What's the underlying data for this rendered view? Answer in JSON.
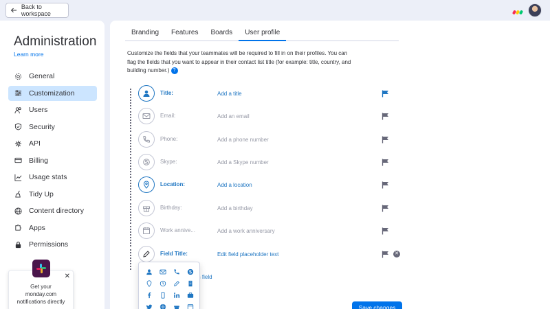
{
  "header": {
    "back_label": "Back to workspace"
  },
  "sidebar": {
    "title": "Administration",
    "learn_more": "Learn more",
    "items": [
      {
        "label": "General",
        "icon": "gear-icon"
      },
      {
        "label": "Customization",
        "icon": "sliders-icon",
        "active": true
      },
      {
        "label": "Users",
        "icon": "users-icon"
      },
      {
        "label": "Security",
        "icon": "shield-icon"
      },
      {
        "label": "API",
        "icon": "api-icon"
      },
      {
        "label": "Billing",
        "icon": "billing-icon"
      },
      {
        "label": "Usage stats",
        "icon": "chart-icon"
      },
      {
        "label": "Tidy Up",
        "icon": "broom-icon"
      },
      {
        "label": "Content directory",
        "icon": "globe-icon"
      },
      {
        "label": "Apps",
        "icon": "puzzle-icon"
      },
      {
        "label": "Permissions",
        "icon": "lock-icon"
      }
    ],
    "slack_promo": {
      "line1": "Get your",
      "line2": "monday.com",
      "line3": "notifications directly",
      "close": "✕"
    }
  },
  "tabs": [
    {
      "label": "Branding"
    },
    {
      "label": "Features"
    },
    {
      "label": "Boards"
    },
    {
      "label": "User profile",
      "active": true
    }
  ],
  "description": "Customize the fields that your teammates will be required to fill in on their profiles. You can flag the fields that you want to appear in their contact list title (for example: title, country, and building number.)",
  "help_icon": "?",
  "fields": [
    {
      "name": "Title:",
      "placeholder": "Add a title",
      "enabled": true,
      "flagged": true,
      "icon": "person-icon"
    },
    {
      "name": "Email:",
      "placeholder": "Add an email",
      "enabled": false,
      "flagged": false,
      "icon": "mail-icon"
    },
    {
      "name": "Phone:",
      "placeholder": "Add a phone number",
      "enabled": false,
      "flagged": false,
      "icon": "phone-icon"
    },
    {
      "name": "Skype:",
      "placeholder": "Add a Skype number",
      "enabled": false,
      "flagged": false,
      "icon": "skype-icon"
    },
    {
      "name": "Location:",
      "placeholder": "Add a location",
      "enabled": true,
      "flagged": false,
      "icon": "location-icon"
    },
    {
      "name": "Birthday:",
      "placeholder": "Add a birthday",
      "enabled": false,
      "flagged": false,
      "icon": "gift-icon"
    },
    {
      "name": "Work annive...",
      "placeholder": "Add a work anniversary",
      "enabled": false,
      "flagged": false,
      "icon": "calendar-icon"
    },
    {
      "name": "Field Title:",
      "placeholder": "Edit field placeholder text",
      "enabled": true,
      "flagged": false,
      "icon": "pencil-icon",
      "removable": true
    }
  ],
  "custom_field_label": "m field",
  "save_label": "Save changes",
  "colors": {
    "accent": "#0073ea",
    "active_nav": "#cce5ff",
    "flag_active": "#1f76c2",
    "flag_inactive": "#676879"
  }
}
